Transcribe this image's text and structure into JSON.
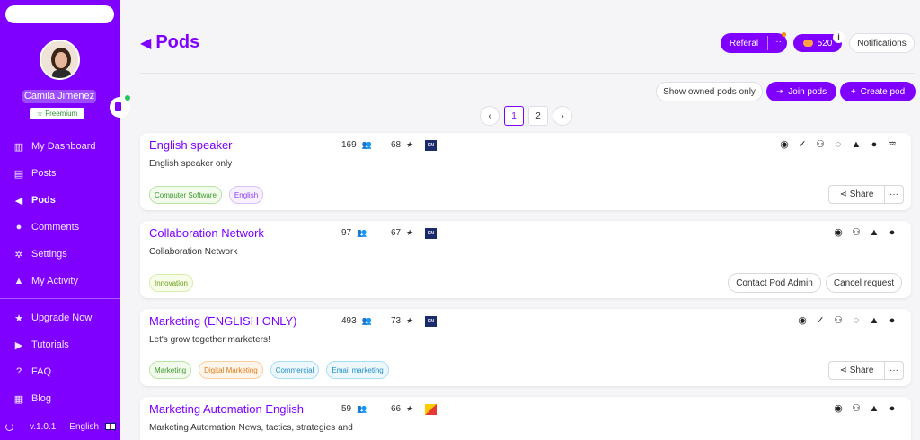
{
  "sidebar": {
    "user_name": "Camila Jimenez",
    "plan": "Freemium",
    "items": [
      {
        "label": "My Dashboard",
        "icon": "chart-icon"
      },
      {
        "label": "Posts",
        "icon": "document-icon"
      },
      {
        "label": "Pods",
        "icon": "megaphone-icon"
      },
      {
        "label": "Comments",
        "icon": "comment-icon"
      },
      {
        "label": "Settings",
        "icon": "gear-icon"
      },
      {
        "label": "My Activity",
        "icon": "user-icon"
      },
      {
        "label": "Upgrade Now",
        "icon": "star-icon"
      },
      {
        "label": "Tutorials",
        "icon": "play-icon"
      },
      {
        "label": "FAQ",
        "icon": "question-icon"
      },
      {
        "label": "Blog",
        "icon": "blog-icon"
      }
    ],
    "version": "v.1.0.1",
    "language": "English"
  },
  "header": {
    "title": "Pods",
    "referral_label": "Referal",
    "more_label": "···",
    "credits": "520",
    "info_label": "i",
    "notifications_label": "Notifications"
  },
  "toolbar": {
    "show_owned_label": "Show owned pods only",
    "join_pods_label": "Join pods",
    "create_pod_label": "Create pod"
  },
  "pagination": {
    "prev": "‹",
    "next": "›",
    "pages": [
      "1",
      "2"
    ],
    "current": "1"
  },
  "pods": [
    {
      "title": "English speaker",
      "members": "169",
      "stars": "68",
      "lang": "EN",
      "description": "English speaker only",
      "tags": [
        "Computer Software",
        "English"
      ],
      "share_label": "Share",
      "more_label": "···"
    },
    {
      "title": "Collaboration Network",
      "members": "97",
      "stars": "67",
      "lang": "EN",
      "description": "Collaboration Network",
      "tags": [
        "Innovation"
      ],
      "contact_label": "Contact Pod Admin",
      "cancel_label": "Cancel request"
    },
    {
      "title": "Marketing (ENGLISH ONLY)",
      "members": "493",
      "stars": "73",
      "lang": "EN",
      "description": "Let's grow together marketers!",
      "tags": [
        "Marketing",
        "Digital Marketing",
        "Commercial",
        "Email marketing"
      ],
      "share_label": "Share",
      "more_label": "···"
    },
    {
      "title": "Marketing Automation English",
      "members": "59",
      "stars": "66",
      "lang": "",
      "description": "Marketing Automation News, tactics, strategies and"
    }
  ],
  "colors": {
    "brand": "#7f00ff",
    "background": "#f5f4f6"
  }
}
